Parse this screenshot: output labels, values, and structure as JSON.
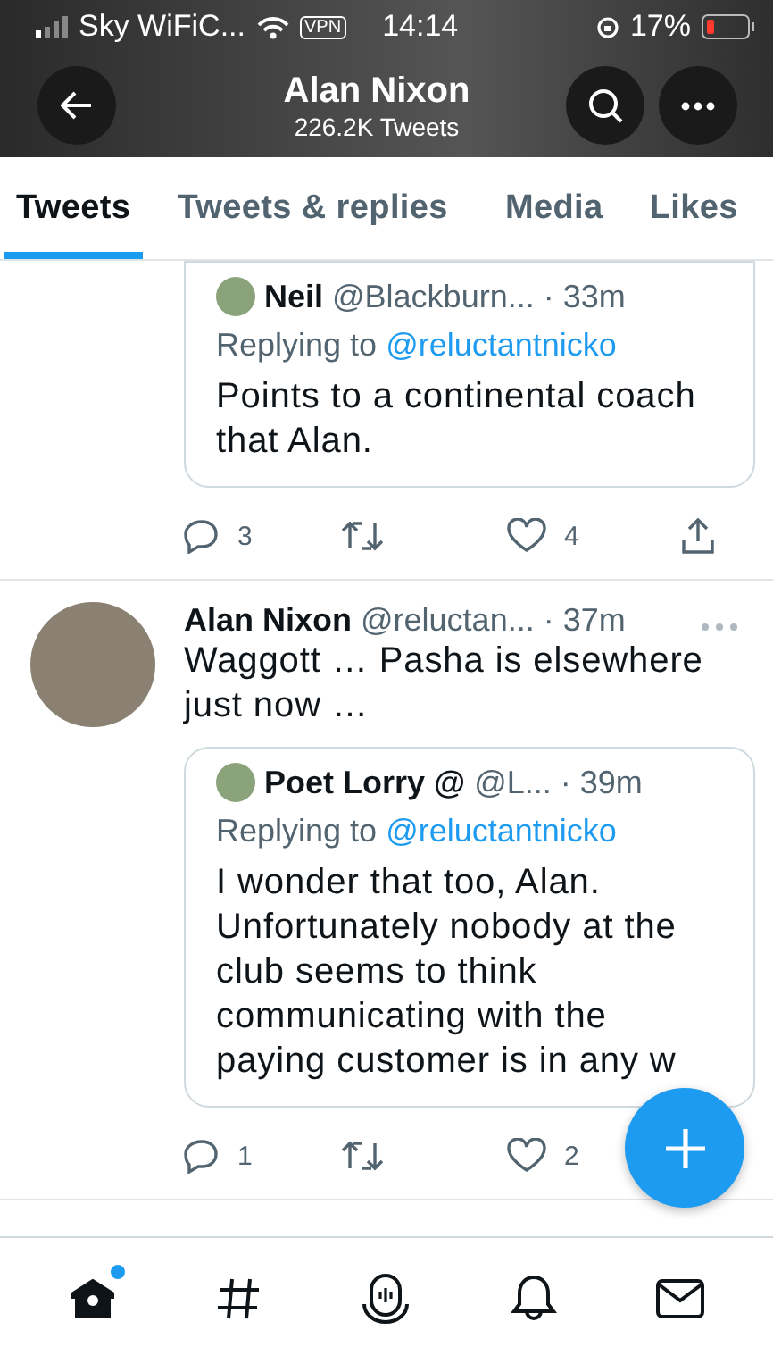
{
  "status_bar": {
    "carrier": "Sky WiFiC...",
    "vpn": "VPN",
    "time": "14:14",
    "battery": "17%"
  },
  "header": {
    "title": "Alan Nixon",
    "subtitle": "226.2K Tweets"
  },
  "tabs": [
    {
      "label": "Tweets",
      "selected": true
    },
    {
      "label": "Tweets & replies",
      "selected": false
    },
    {
      "label": "Media",
      "selected": false
    },
    {
      "label": "Likes",
      "selected": false
    }
  ],
  "tweets": [
    {
      "quote": {
        "name": "Neil",
        "handle": "@Blackburn...",
        "time": "· 33m",
        "replying_label": "Replying to",
        "replying_to": "@reluctantnicko",
        "text": "Points to a continental coach that Alan."
      },
      "replies": "3",
      "likes": "4"
    },
    {
      "author": "Alan Nixon",
      "handle": "@reluctan...",
      "time": "· 37m",
      "text": "Waggott … Pasha is elsewhere just now …",
      "quote": {
        "name": "Poet Lorry @",
        "handle": "@L...",
        "time": "· 39m",
        "replying_label": "Replying to",
        "replying_to": "@reluctantnicko",
        "text": "I wonder that too, Alan. Unfortunately nobody at the club seems to think communicating with the paying customer is in any w"
      },
      "replies": "1",
      "likes": "2"
    }
  ],
  "nav": [
    {
      "kind": "home",
      "dot": true
    },
    {
      "kind": "explore",
      "dot": false
    },
    {
      "kind": "spaces",
      "dot": false
    },
    {
      "kind": "notifications",
      "dot": false
    },
    {
      "kind": "messages",
      "dot": false
    }
  ]
}
